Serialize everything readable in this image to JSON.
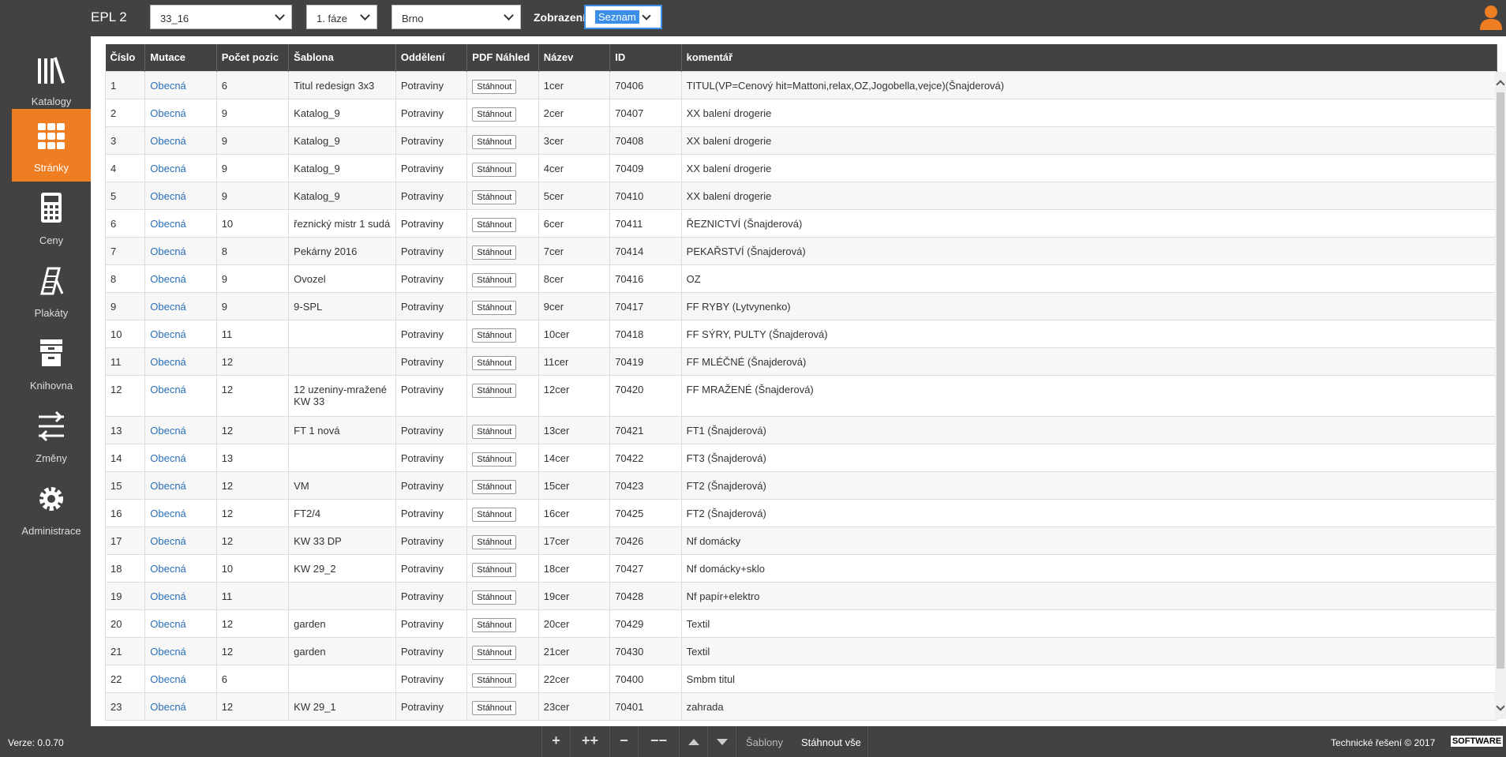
{
  "app": {
    "title": "EPL 2"
  },
  "header": {
    "katalog_select": "33_16",
    "faze_select": "1. fáze",
    "pobocka_select": "Brno",
    "zobrazeni_label": "Zobrazení",
    "zobrazeni_select": "Seznam"
  },
  "sidebar": {
    "items": [
      {
        "label": "Katalogy",
        "icon": "books-icon"
      },
      {
        "label": "Stránky",
        "icon": "grid-icon"
      },
      {
        "label": "Ceny",
        "icon": "calculator-icon"
      },
      {
        "label": "Plakáty",
        "icon": "poster-icon"
      },
      {
        "label": "Knihovna",
        "icon": "archive-icon"
      },
      {
        "label": "Změny",
        "icon": "sliders-icon"
      },
      {
        "label": "Administrace",
        "icon": "gear-icon"
      }
    ]
  },
  "table": {
    "columns": [
      "Číslo",
      "Mutace",
      "Počet pozic",
      "Šablona",
      "Oddělení",
      "PDF Náhled",
      "Název",
      "ID",
      "komentář"
    ],
    "download_label": "Stáhnout",
    "rows": [
      {
        "cislo": "1",
        "mutace": "Obecná",
        "pocet": "6",
        "sablona": "Titul redesign 3x3",
        "oddeleni": "Potraviny",
        "nazev": "1cer",
        "id": "70406",
        "komentar": "TITUL(VP=Cenový hit=Mattoni,relax,OZ,Jogobella,vejce)(Šnajderová)"
      },
      {
        "cislo": "2",
        "mutace": "Obecná",
        "pocet": "9",
        "sablona": "Katalog_9",
        "oddeleni": "Potraviny",
        "nazev": "2cer",
        "id": "70407",
        "komentar": "XX balení drogerie"
      },
      {
        "cislo": "3",
        "mutace": "Obecná",
        "pocet": "9",
        "sablona": "Katalog_9",
        "oddeleni": "Potraviny",
        "nazev": "3cer",
        "id": "70408",
        "komentar": "XX balení drogerie"
      },
      {
        "cislo": "4",
        "mutace": "Obecná",
        "pocet": "9",
        "sablona": "Katalog_9",
        "oddeleni": "Potraviny",
        "nazev": "4cer",
        "id": "70409",
        "komentar": "XX balení drogerie"
      },
      {
        "cislo": "5",
        "mutace": "Obecná",
        "pocet": "9",
        "sablona": "Katalog_9",
        "oddeleni": "Potraviny",
        "nazev": "5cer",
        "id": "70410",
        "komentar": "XX balení drogerie"
      },
      {
        "cislo": "6",
        "mutace": "Obecná",
        "pocet": "10",
        "sablona": "řeznický mistr 1 sudá",
        "oddeleni": "Potraviny",
        "nazev": "6cer",
        "id": "70411",
        "komentar": "ŘEZNICTVÍ (Šnajderová)"
      },
      {
        "cislo": "7",
        "mutace": "Obecná",
        "pocet": "8",
        "sablona": "Pekárny 2016",
        "oddeleni": "Potraviny",
        "nazev": "7cer",
        "id": "70414",
        "komentar": "PEKAŘSTVÍ (Šnajderová)"
      },
      {
        "cislo": "8",
        "mutace": "Obecná",
        "pocet": "9",
        "sablona": "Ovozel",
        "oddeleni": "Potraviny",
        "nazev": "8cer",
        "id": "70416",
        "komentar": "OZ"
      },
      {
        "cislo": "9",
        "mutace": "Obecná",
        "pocet": "9",
        "sablona": "9-SPL",
        "oddeleni": "Potraviny",
        "nazev": "9cer",
        "id": "70417",
        "komentar": "FF RYBY (Lytvynenko)"
      },
      {
        "cislo": "10",
        "mutace": "Obecná",
        "pocet": "11",
        "sablona": "",
        "oddeleni": "Potraviny",
        "nazev": "10cer",
        "id": "70418",
        "komentar": "FF SÝRY, PULTY (Šnajderová)"
      },
      {
        "cislo": "11",
        "mutace": "Obecná",
        "pocet": "12",
        "sablona": "",
        "oddeleni": "Potraviny",
        "nazev": "11cer",
        "id": "70419",
        "komentar": "FF MLÉČNÉ (Šnajderová)"
      },
      {
        "cislo": "12",
        "mutace": "Obecná",
        "pocet": "12",
        "sablona": "12 uzeniny-mražené KW 33",
        "oddeleni": "Potraviny",
        "nazev": "12cer",
        "id": "70420",
        "komentar": "FF MRAŽENÉ (Šnajderová)",
        "tall": true
      },
      {
        "cislo": "13",
        "mutace": "Obecná",
        "pocet": "12",
        "sablona": "FT 1 nová",
        "oddeleni": "Potraviny",
        "nazev": "13cer",
        "id": "70421",
        "komentar": "FT1 (Šnajderová)"
      },
      {
        "cislo": "14",
        "mutace": "Obecná",
        "pocet": "13",
        "sablona": "",
        "oddeleni": "Potraviny",
        "nazev": "14cer",
        "id": "70422",
        "komentar": "FT3 (Šnajderová)"
      },
      {
        "cislo": "15",
        "mutace": "Obecná",
        "pocet": "12",
        "sablona": "VM",
        "oddeleni": "Potraviny",
        "nazev": "15cer",
        "id": "70423",
        "komentar": "FT2 (Šnajderová)"
      },
      {
        "cislo": "16",
        "mutace": "Obecná",
        "pocet": "12",
        "sablona": "FT2/4",
        "oddeleni": "Potraviny",
        "nazev": "16cer",
        "id": "70425",
        "komentar": "FT2 (Šnajderová)"
      },
      {
        "cislo": "17",
        "mutace": "Obecná",
        "pocet": "12",
        "sablona": "KW 33 DP",
        "oddeleni": "Potraviny",
        "nazev": "17cer",
        "id": "70426",
        "komentar": "Nf domácky"
      },
      {
        "cislo": "18",
        "mutace": "Obecná",
        "pocet": "10",
        "sablona": "KW 29_2",
        "oddeleni": "Potraviny",
        "nazev": "18cer",
        "id": "70427",
        "komentar": "Nf domácky+sklo"
      },
      {
        "cislo": "19",
        "mutace": "Obecná",
        "pocet": "11",
        "sablona": "",
        "oddeleni": "Potraviny",
        "nazev": "19cer",
        "id": "70428",
        "komentar": "Nf papír+elektro"
      },
      {
        "cislo": "20",
        "mutace": "Obecná",
        "pocet": "12",
        "sablona": "garden",
        "oddeleni": "Potraviny",
        "nazev": "20cer",
        "id": "70429",
        "komentar": "Textil"
      },
      {
        "cislo": "21",
        "mutace": "Obecná",
        "pocet": "12",
        "sablona": "garden",
        "oddeleni": "Potraviny",
        "nazev": "21cer",
        "id": "70430",
        "komentar": "Textil"
      },
      {
        "cislo": "22",
        "mutace": "Obecná",
        "pocet": "6",
        "sablona": "",
        "oddeleni": "Potraviny",
        "nazev": "22cer",
        "id": "70400",
        "komentar": "Smbm titul"
      },
      {
        "cislo": "23",
        "mutace": "Obecná",
        "pocet": "12",
        "sablona": "KW 29_1",
        "oddeleni": "Potraviny",
        "nazev": "23cer",
        "id": "70401",
        "komentar": "zahrada"
      }
    ]
  },
  "footer": {
    "version": "Verze: 0.0.70",
    "add": "+",
    "add_more": "++",
    "remove": "−",
    "remove_more": "−−",
    "sablony": "Šablony",
    "download_all": "Stáhnout vše",
    "credit": "Technické řešení © 2017",
    "logo_text": "SOFTWARE"
  },
  "colors": {
    "accent": "#ef7d22",
    "dark": "#424242",
    "link": "#2a6fb7",
    "select_highlight": "#3b8ee8"
  }
}
